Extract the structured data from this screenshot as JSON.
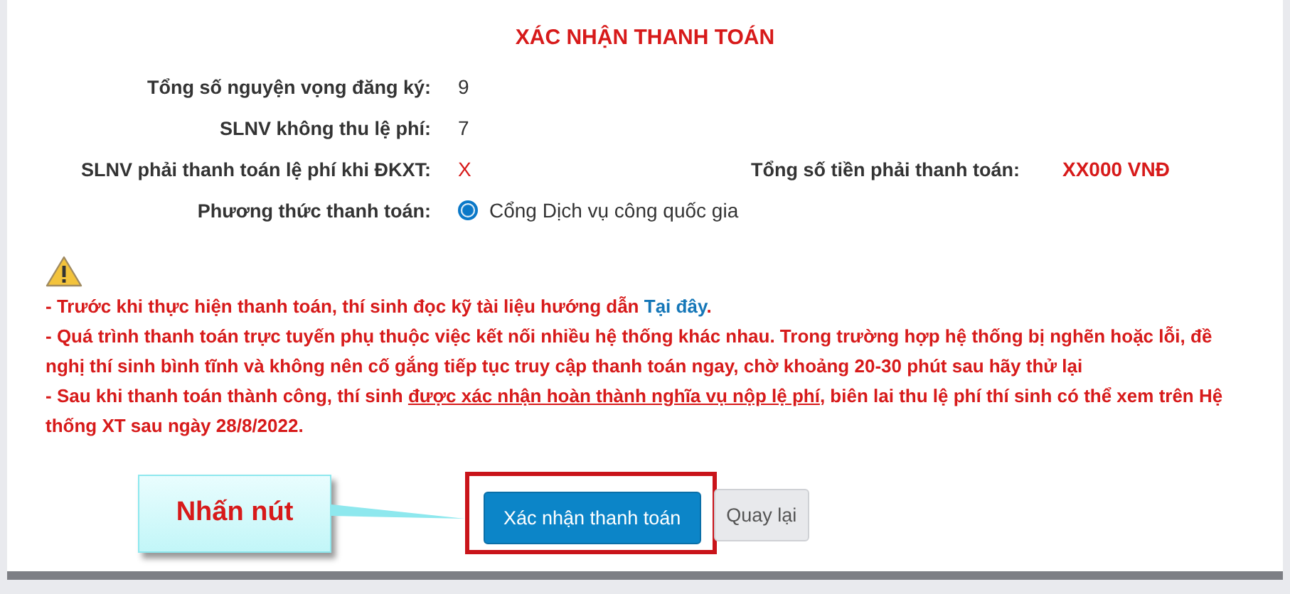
{
  "title": "XÁC NHẬN THANH TOÁN",
  "fields": [
    {
      "label": "Tổng số nguyện vọng đăng ký:",
      "value": "9",
      "kind": "text"
    },
    {
      "label": "SLNV không thu lệ phí:",
      "value": "7",
      "kind": "text"
    },
    {
      "label": "SLNV phải thanh toán lệ phí khi ĐKXT:",
      "value": "X",
      "kind": "highlight",
      "extra_label": "Tổng số tiền phải thanh toán:",
      "extra_value": "XX000 VNĐ"
    },
    {
      "label": "Phương thức thanh toán:",
      "value": "Cổng Dịch vụ công quốc gia",
      "kind": "radio",
      "selected": true
    }
  ],
  "notes": [
    {
      "text": "- Trước khi thực hiện thanh toán, thí sinh đọc kỹ tài liệu hướng dẫn ",
      "link": "Tại đây",
      "after": "."
    },
    {
      "text": "- Quá trình thanh toán trực tuyến phụ thuộc việc kết nối nhiều hệ thống khác nhau. Trong trường hợp hệ thống bị nghẽn hoặc lỗi, đề nghị thí sinh bình tĩnh và không nên cố gắng tiếp tục truy cập thanh toán ngay, chờ khoảng 20-30 phút sau hãy thử lại"
    },
    {
      "text": "- Sau khi thanh toán thành công, thí sinh ",
      "underlined": "được xác nhận hoàn thành nghĩa vụ nộp lệ phí",
      "after": ", biên lai thu lệ phí thí sinh có thể xem trên Hệ thống XT sau ngày 28/8/2022."
    }
  ],
  "callout": "Nhấn nút",
  "buttons": [
    {
      "label": "Xác nhận thanh toán",
      "kind": "primary"
    },
    {
      "label": "Quay lại",
      "kind": "secondary"
    }
  ]
}
